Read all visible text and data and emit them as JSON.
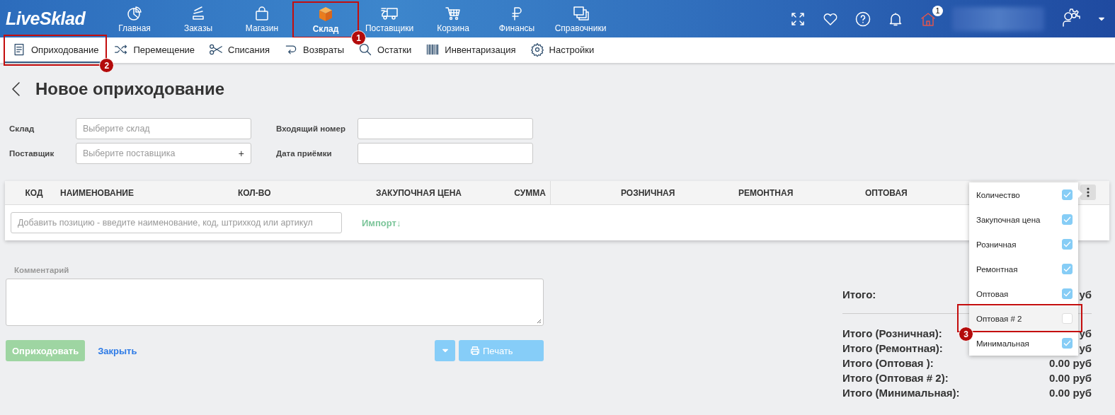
{
  "header": {
    "logo": "LiveSklad",
    "nav": [
      {
        "label": "Главная",
        "selected": false
      },
      {
        "label": "Заказы",
        "selected": false
      },
      {
        "label": "Магазин",
        "selected": false
      },
      {
        "label": "Склад",
        "selected": true,
        "annotation": "1"
      },
      {
        "label": "Поставщики",
        "selected": false
      },
      {
        "label": "Корзина",
        "selected": false
      },
      {
        "label": "Финансы",
        "selected": false
      },
      {
        "label": "Справочники",
        "selected": false
      }
    ],
    "notification_count": "1"
  },
  "subnav": [
    {
      "label": "Оприходование",
      "selected": true,
      "annotation": "2"
    },
    {
      "label": "Перемещение",
      "selected": false
    },
    {
      "label": "Списания",
      "selected": false
    },
    {
      "label": "Возвраты",
      "selected": false
    },
    {
      "label": "Остатки",
      "selected": false
    },
    {
      "label": "Инвентаризация",
      "selected": false
    },
    {
      "label": "Настройки",
      "selected": false
    }
  ],
  "page_title": "Новое оприходование",
  "form": [
    {
      "label": "Склад",
      "placeholder": "Выберите склад"
    },
    {
      "label": "Входящий номер"
    },
    {
      "label": "Поставщик",
      "placeholder": "Выберите поставщика",
      "add": "+"
    },
    {
      "label": "Дата приёмки"
    }
  ],
  "table": {
    "columns": [
      "КОД",
      "НАИМЕНОВАНИЕ",
      "КОЛ-ВО",
      "ЗАКУПОЧНАЯ ЦЕНА",
      "СУММА",
      "РОЗНИЧНАЯ",
      "РЕМОНТНАЯ",
      "ОПТОВАЯ"
    ],
    "add_placeholder": "Добавить позицию - введите наименование, код, штрихкод или артикул",
    "import_link": "Импорт↓"
  },
  "column_menu": [
    {
      "label": "Количество",
      "checked": true,
      "selected": false
    },
    {
      "label": "Закупочная цена",
      "checked": true,
      "selected": false
    },
    {
      "label": "Розничная",
      "checked": true,
      "selected": false
    },
    {
      "label": "Ремонтная",
      "checked": true,
      "selected": false
    },
    {
      "label": "Оптовая",
      "checked": true,
      "selected": false
    },
    {
      "label": "Оптовая # 2",
      "checked": false,
      "selected": true,
      "annotation": "3"
    },
    {
      "label": "Минимальная",
      "checked": true,
      "selected": false
    }
  ],
  "comment": {
    "label": "Комментарий"
  },
  "actions": {
    "submit": {
      "label": "Оприходовать",
      "disabled": true
    },
    "close": "Закрыть",
    "print": {
      "label": "Печать",
      "disabled": true
    }
  },
  "totals": {
    "main": {
      "label": "Итого:",
      "value": "уб"
    },
    "rows": [
      {
        "label": "Итого (Розничная):",
        "value": "уб"
      },
      {
        "label": "Итого (Ремонтная):",
        "value": "уб"
      },
      {
        "label": "Итого (Оптовая ):",
        "value": "0.00 руб"
      },
      {
        "label": "Итого (Оптовая # 2):",
        "value": "0.00 руб"
      },
      {
        "label": "Итого (Минимальная):",
        "value": "0.00 руб"
      }
    ]
  }
}
